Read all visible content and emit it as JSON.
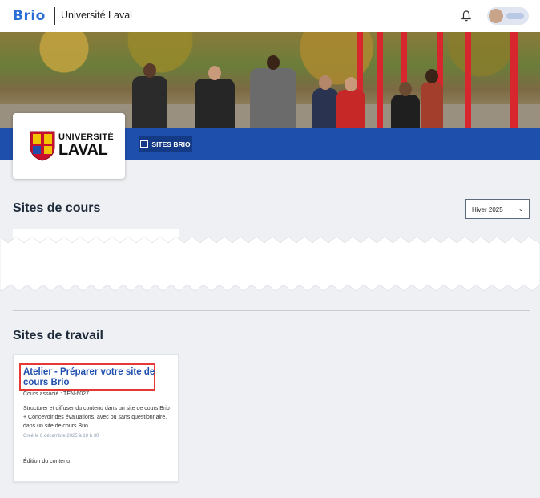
{
  "header": {
    "app_name": "Brio",
    "institution": "Université Laval",
    "bell_icon": "bell-icon"
  },
  "brand": {
    "logo_line1": "UNIVERSITÉ",
    "logo_line2": "LAVAL",
    "nav_button": "SITES BRIO",
    "colors": {
      "blue_bar": "#1f4fad",
      "accent_red": "#e53935",
      "title_blue": "#1f4fad"
    }
  },
  "courses_section": {
    "title": "Sites de cours",
    "session_select": "Hiver 2025"
  },
  "work_section": {
    "title": "Sites de travail",
    "card": {
      "title": "Atelier - Préparer votre site de cours Brio",
      "course": "Cours associé : TEN-6027",
      "description": "Structurer et diffuser du contenu dans un site de cours Brio + Concevoir des évaluations, avec ou sans questionnaire, dans un site de cours Brio",
      "created": "Créé le 8 décembre 2025 à 10 h 30",
      "role": "Édition du contenu"
    }
  }
}
